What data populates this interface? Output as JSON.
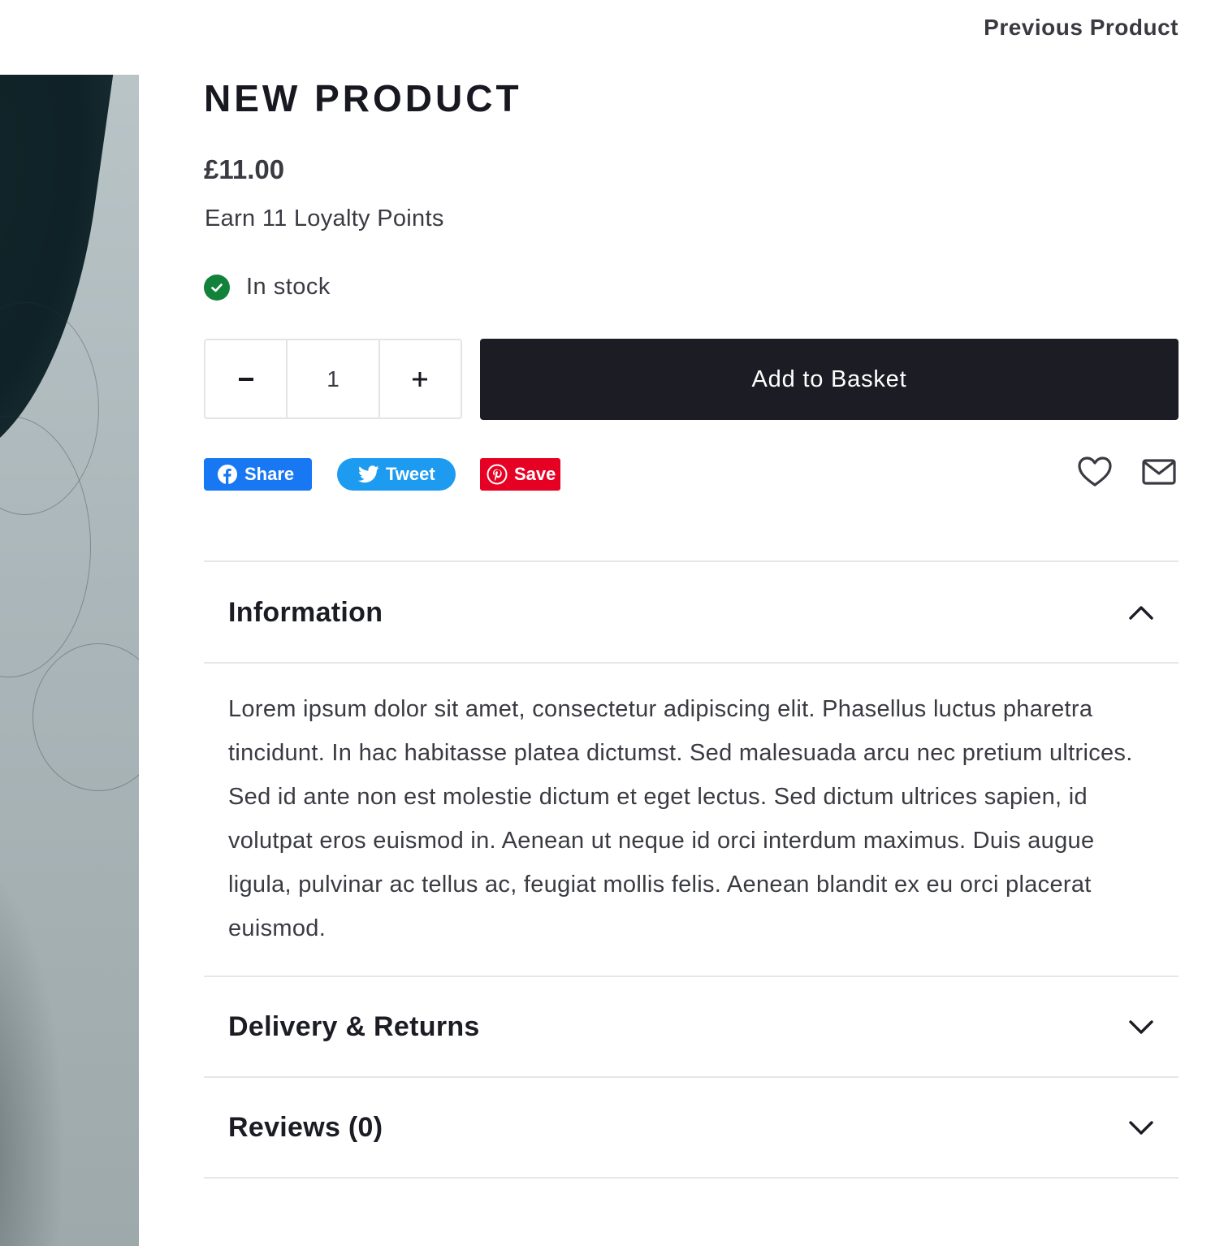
{
  "navigation": {
    "previous_label": "Previous Product"
  },
  "product": {
    "title": "NEW PRODUCT",
    "price": "£11.00",
    "loyalty": "Earn 11 Loyalty Points",
    "stock_status": "In stock",
    "stock_color": "#12813a"
  },
  "quantity": {
    "decrement": "–",
    "value": "1",
    "increment": "+"
  },
  "basket": {
    "label": "Add to Basket",
    "color": "#1c1d24"
  },
  "social": {
    "share": {
      "label": "Share",
      "icon": "facebook-icon",
      "color": "#1877f2"
    },
    "tweet": {
      "label": "Tweet",
      "icon": "twitter-bird-icon",
      "color": "#1d9bf0"
    },
    "save": {
      "label": "Save",
      "icon": "pinterest-icon",
      "color": "#e60023"
    },
    "wishlist_icon": "heart-icon",
    "email_icon": "envelope-icon"
  },
  "accordion": {
    "information": {
      "title": "Information",
      "expanded": true,
      "body": "Lorem ipsum dolor sit amet, consectetur adipiscing elit. Phasellus luctus pharetra tincidunt. In hac habitasse platea dictumst. Sed malesuada arcu nec pretium ultrices. Sed id ante non est molestie dictum et eget lectus. Sed dictum ultrices sapien, id volutpat eros euismod in. Aenean ut neque id orci interdum maximus. Duis augue ligula, pulvinar ac tellus ac, feugiat mollis felis. Aenean blandit ex eu orci placerat euismod."
    },
    "delivery": {
      "title": "Delivery & Returns",
      "expanded": false
    },
    "reviews": {
      "title": "Reviews (0)",
      "expanded": false
    }
  }
}
